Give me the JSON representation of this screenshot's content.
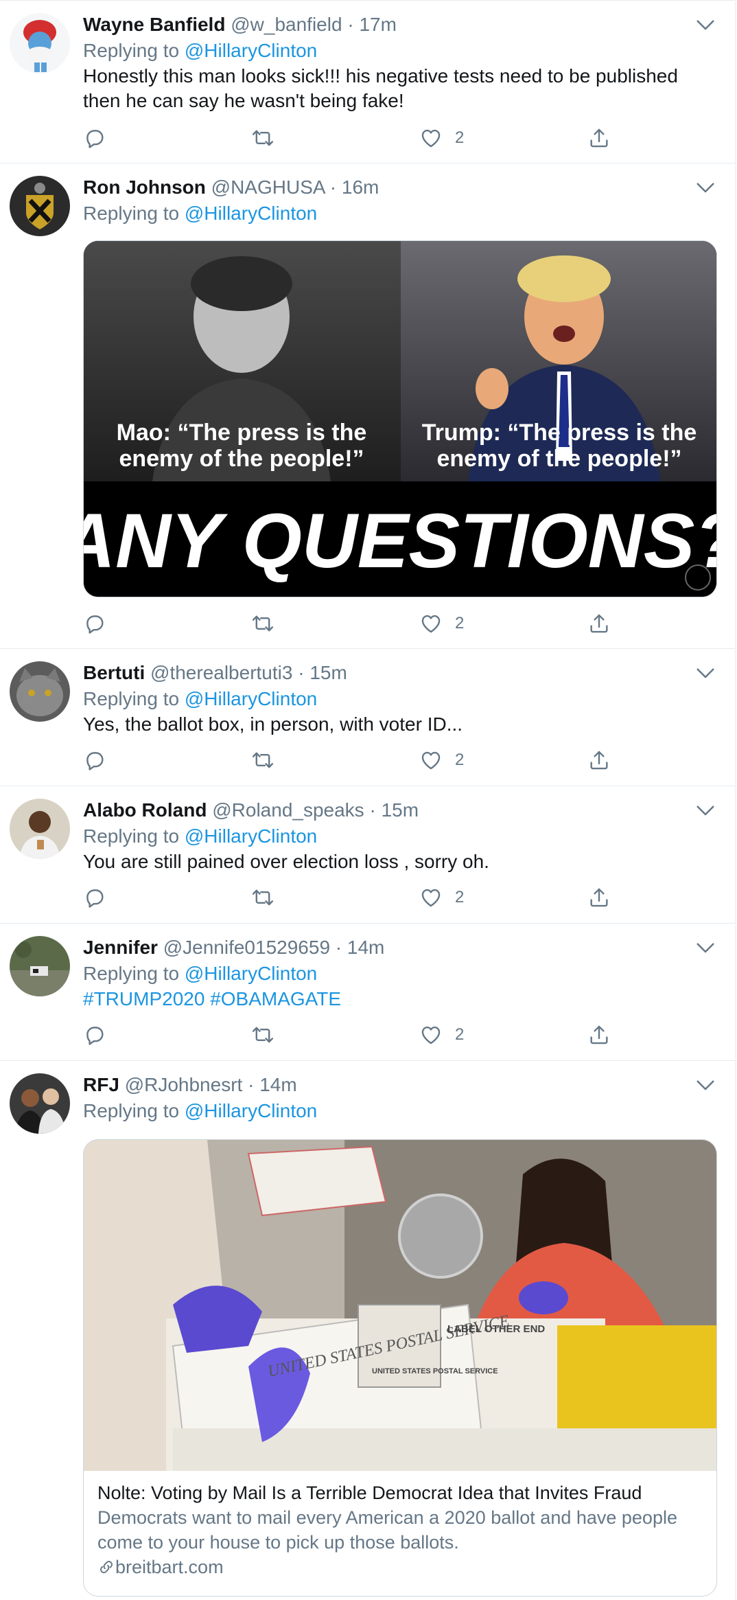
{
  "colors": {
    "accent": "#1b95e0",
    "muted": "#657786",
    "text": "#14171a",
    "border": "#e6ecf0"
  },
  "icons": {
    "reply": "reply-icon",
    "retweet": "retweet-icon",
    "like": "heart-icon",
    "share": "share-icon",
    "caret": "chevron-down-icon",
    "link": "link-icon"
  },
  "tweets": [
    {
      "name": "Wayne Banfield",
      "handle": "@w_banfield",
      "sep": " · ",
      "time": "17m",
      "replying_prefix": "Replying to ",
      "replying_to": "@HillaryClinton",
      "text": "Honestly this man looks sick!!! his negative tests need to be published then he can say he wasn't being fake!",
      "likes": "2"
    },
    {
      "name": "Ron Johnson",
      "handle": "@NAGHUSA",
      "sep": " · ",
      "time": "16m",
      "replying_prefix": "Replying to ",
      "replying_to": "@HillaryClinton",
      "image": {
        "left_caption_1": "Mao: “The press is the",
        "left_caption_2": "enemy of the people!”",
        "right_caption_1": "Trump: “The press is the",
        "right_caption_2": "enemy of the people!”",
        "headline": "ANY QUESTIONS?"
      },
      "likes": "2"
    },
    {
      "name": "Bertuti",
      "handle": "@therealbertuti3",
      "sep": " · ",
      "time": "15m",
      "replying_prefix": "Replying to ",
      "replying_to": "@HillaryClinton",
      "text": "Yes, the ballot box, in person, with voter ID...",
      "likes": "2"
    },
    {
      "name": "Alabo Roland",
      "handle": "@Roland_speaks",
      "sep": " · ",
      "time": "15m",
      "replying_prefix": "Replying to ",
      "replying_to": "@HillaryClinton",
      "text": "You are still pained over election loss , sorry oh.",
      "likes": "2"
    },
    {
      "name": "Jennifer",
      "handle": "@Jennife01529659",
      "sep": " · ",
      "time": "14m",
      "replying_prefix": "Replying to ",
      "replying_to": "@HillaryClinton",
      "hashtags": [
        "#TRUMP2020",
        "#OBAMAGATE"
      ],
      "likes": "2"
    },
    {
      "name": "RFJ",
      "handle": "@RJohbnesrt",
      "sep": " · ",
      "time": "14m",
      "replying_prefix": "Replying to ",
      "replying_to": "@HillaryClinton",
      "card": {
        "image_text_1": "UNITED STATES POSTAL SERVICE",
        "image_text_2": "LABEL OTHER END",
        "image_text_3": "UNITED STATES POSTAL SERVICE",
        "title": "Nolte: Voting by Mail Is a Terrible Democrat Idea that Invites Fraud",
        "description": "Democrats want to mail every American a 2020 ballot and have people come to your house to pick up those ballots.",
        "domain": "breitbart.com"
      }
    }
  ]
}
